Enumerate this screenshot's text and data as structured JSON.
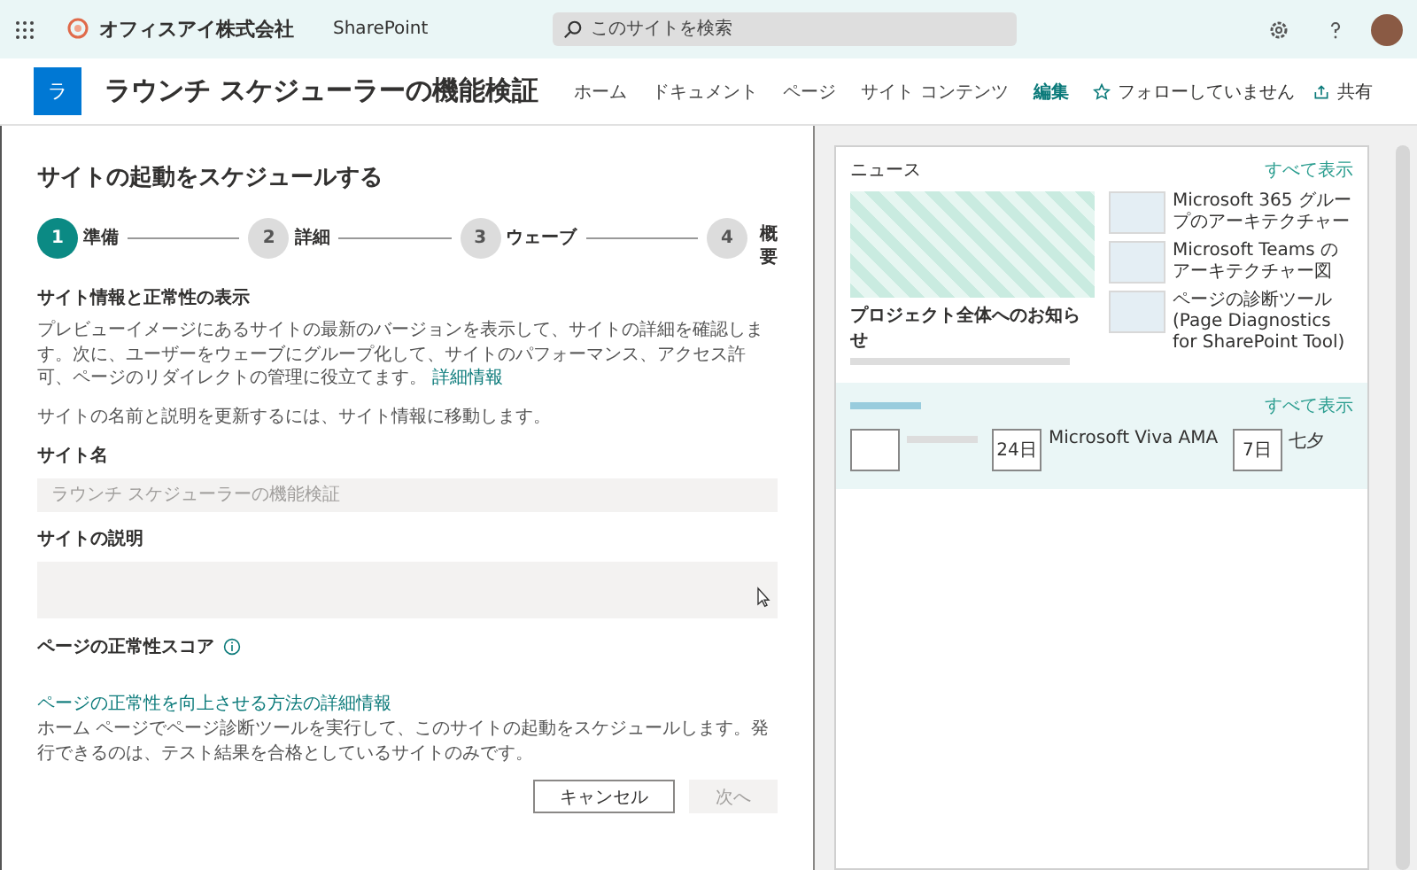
{
  "suite_bar": {
    "org_name": "オフィスアイ株式会社",
    "app_name": "SharePoint",
    "search": {
      "placeholder": "このサイトを検索"
    }
  },
  "site_header": {
    "logo_letter": "ラ",
    "title": "ラウンチ スケジューラーの機能検証",
    "nav": [
      {
        "label": "ホーム",
        "selected": false
      },
      {
        "label": "ドキュメント",
        "selected": false
      },
      {
        "label": "ページ",
        "selected": false
      },
      {
        "label": "サイト コンテンツ",
        "selected": false
      },
      {
        "label": "編集",
        "selected": true
      }
    ],
    "follow": "フォローしていません",
    "share": "共有"
  },
  "panel": {
    "title": "サイトの起動をスケジュールする",
    "steps": [
      {
        "number": "1",
        "label": "準備",
        "selected": true
      },
      {
        "number": "2",
        "label": "詳細",
        "selected": false
      },
      {
        "number": "3",
        "label": "ウェーブ",
        "selected": false
      },
      {
        "number": "4",
        "label": "概要",
        "selected": false
      }
    ],
    "section_title": "サイト情報と正常性の表示",
    "intro": "プレビューイメージにあるサイトの最新のバージョンを表示して、サイトの詳細を確認します。次に、ユーザーをウェーブにグループ化して、サイトのパフォーマンス、アクセス許可、ページのリダイレクトの管理に役立てます。",
    "intro_link": "詳細情報",
    "note": "サイトの名前と説明を更新するには、サイト情報に移動します。",
    "fields": [
      {
        "kind": "input",
        "label": "サイト名",
        "placeholder": "ラウンチ スケジューラーの機能検証"
      },
      {
        "kind": "textarea",
        "label": "サイトの説明"
      }
    ],
    "health_label": "ページの正常性スコア",
    "health_link": "ページの正常性を向上させる方法の詳細情報",
    "health_text": "ホーム ページでページ診断ツールを実行して、このサイトの起動をスケジュールします。発行できるのは、テスト結果を合格としているサイトのみです。",
    "buttons": [
      {
        "label": "キャンセル",
        "disabled": false
      },
      {
        "label": "次へ",
        "disabled": true
      }
    ]
  },
  "preview": {
    "news_title": "ニュース",
    "see_all": "すべて表示",
    "featured_title": "プロジェクト全体へのお知らせ",
    "articles": [
      {
        "title": "Microsoft 365 グループのアーキテクチャー"
      },
      {
        "title": "Microsoft Teams のアーキテクチャー図"
      },
      {
        "title": "ページの診断ツール (Page Diagnostics for SharePoint Tool)"
      }
    ],
    "events_see_all": "すべて表示",
    "events": [
      {
        "date": "24日",
        "title": "Microsoft Viva AMA"
      },
      {
        "date": "7日",
        "title": "七夕"
      }
    ]
  }
}
